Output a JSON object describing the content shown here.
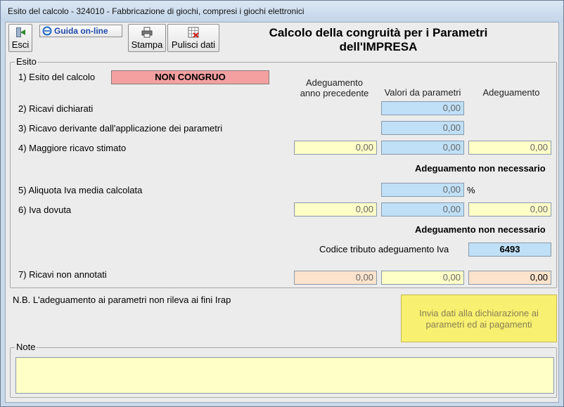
{
  "window": {
    "title": "Esito del calcolo - 324010 - Fabbricazione di giochi, compresi i giochi elettronici"
  },
  "toolbar": {
    "exit_label": "Esci",
    "guide_label": "Guida on-line",
    "print_label": "Stampa",
    "clear_label": "Pulisci dati"
  },
  "page_title_line1": "Calcolo della congruità per i Parametri",
  "page_title_line2": "dell'IMPRESA",
  "esito": {
    "legend": "Esito",
    "row1_label": "1) Esito del calcolo",
    "row1_value": "NON CONGRUO",
    "col_prev_line1": "Adeguamento",
    "col_prev_line2": "anno precedente",
    "col_params": "Valori da parametri",
    "col_adj": "Adeguamento",
    "row2_label": "2) Ricavi dichiarati",
    "row2_params": "0,00",
    "row3_label": "3) Ricavo derivante dall'applicazione dei parametri",
    "row3_params": "0,00",
    "row4_label": "4) Maggiore ricavo stimato",
    "row4_prev": "0,00",
    "row4_params": "0,00",
    "row4_adj": "0,00",
    "status1": "Adeguamento non necessario",
    "row5_label": "5) Aliquota Iva media calcolata",
    "row5_params": "0,00",
    "row5_unit": "%",
    "row6_label": "6) Iva dovuta",
    "row6_prev": "0,00",
    "row6_params": "0,00",
    "row6_adj": "0,00",
    "status2": "Adeguamento non necessario",
    "codice_label": "Codice tributo adeguamento Iva",
    "codice_value": "6493",
    "row7_label": "7) Ricavi non annotati",
    "row7_prev": "0,00",
    "row7_params": "0,00",
    "row7_adj": "0,00"
  },
  "note_irap": "N.B. L'adeguamento ai parametri non rileva ai fini Irap",
  "send_button_line1": "Invia dati alla dichiarazione ai",
  "send_button_line2": "parametri ed ai pagamenti",
  "note": {
    "legend": "Note"
  }
}
